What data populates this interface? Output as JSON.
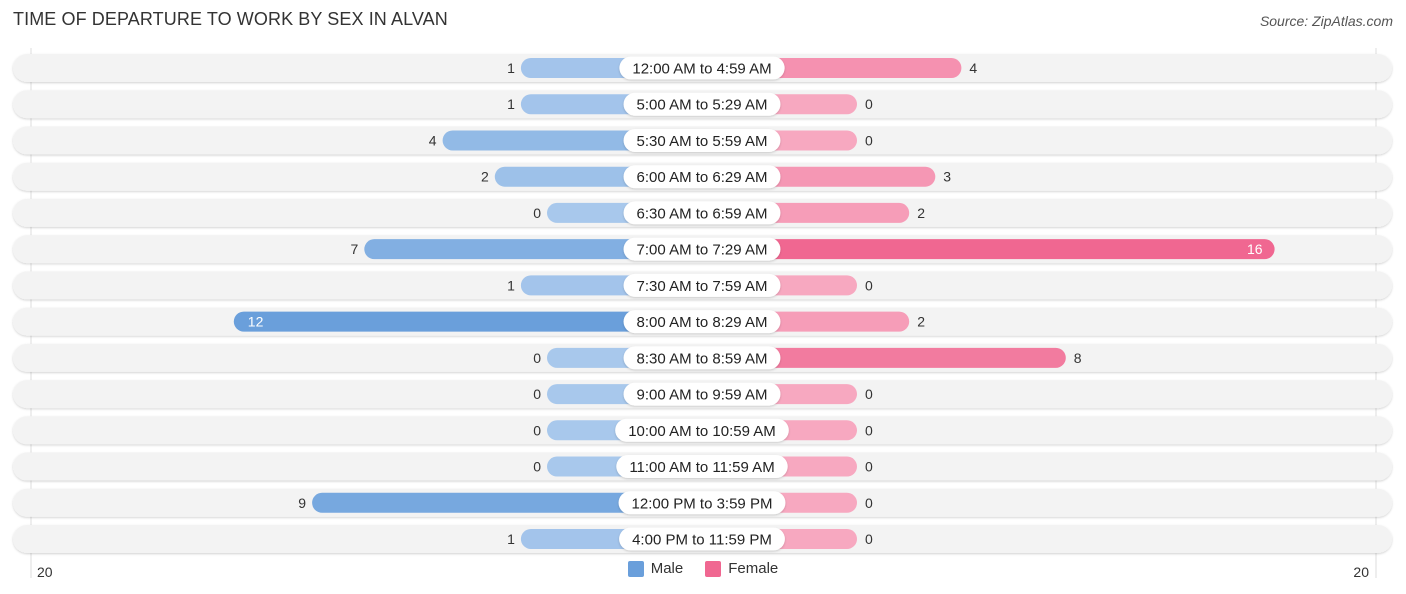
{
  "header": {
    "title": "TIME OF DEPARTURE TO WORK BY SEX IN ALVAN",
    "source": "Source: ZipAtlas.com"
  },
  "colors": {
    "male_strong": "#6a9fdb",
    "male_light": "#a8c8ec",
    "female_strong": "#f06791",
    "female_light": "#f7a8c0",
    "row_bg": "#f3f3f3",
    "label_bg": "#ffffff"
  },
  "chart_data": {
    "type": "bar",
    "orientation": "horizontal-diverging",
    "title": "TIME OF DEPARTURE TO WORK BY SEX IN ALVAN",
    "xlabel": "",
    "ylabel": "",
    "xlim": [
      -20,
      20
    ],
    "axis_tick_labels": {
      "left": "20",
      "right": "20"
    },
    "legend_position": "bottom-center",
    "categories": [
      "12:00 AM to 4:59 AM",
      "5:00 AM to 5:29 AM",
      "5:30 AM to 5:59 AM",
      "6:00 AM to 6:29 AM",
      "6:30 AM to 6:59 AM",
      "7:00 AM to 7:29 AM",
      "7:30 AM to 7:59 AM",
      "8:00 AM to 8:29 AM",
      "8:30 AM to 8:59 AM",
      "9:00 AM to 9:59 AM",
      "10:00 AM to 10:59 AM",
      "11:00 AM to 11:59 AM",
      "12:00 PM to 3:59 PM",
      "4:00 PM to 11:59 PM"
    ],
    "series": [
      {
        "name": "Male",
        "side": "left",
        "values": [
          1,
          1,
          4,
          2,
          0,
          7,
          1,
          12,
          0,
          0,
          0,
          0,
          9,
          1
        ]
      },
      {
        "name": "Female",
        "side": "right",
        "values": [
          4,
          0,
          0,
          3,
          2,
          16,
          0,
          2,
          8,
          0,
          0,
          0,
          0,
          0
        ]
      }
    ]
  },
  "legend": {
    "items": [
      {
        "label": "Male",
        "color": "#6a9fdb"
      },
      {
        "label": "Female",
        "color": "#f06791"
      }
    ]
  }
}
